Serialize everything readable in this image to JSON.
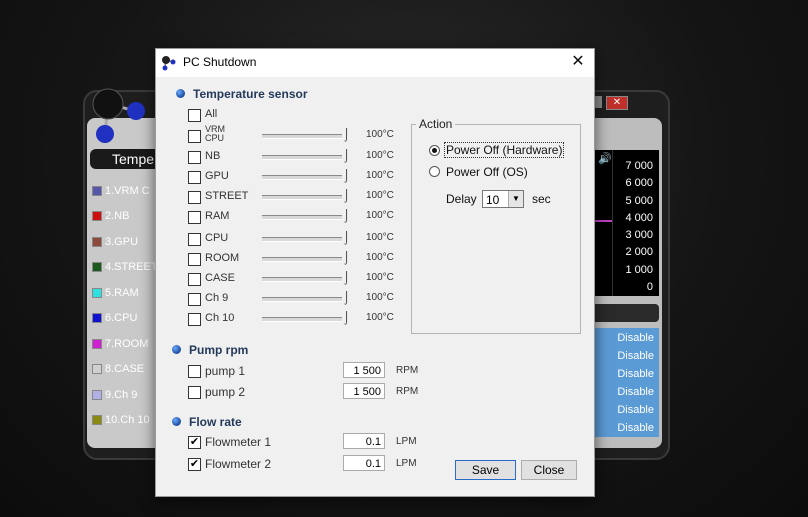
{
  "background_app": {
    "left_header": "Tempe",
    "channels": [
      {
        "label": "1.VRM C",
        "color": "#5555aa"
      },
      {
        "label": "2.NB",
        "color": "#d01010"
      },
      {
        "label": "3.GPU",
        "color": "#8b4a3a"
      },
      {
        "label": "4.STREET",
        "color": "#1a5a1a"
      },
      {
        "label": "5.RAM",
        "color": "#30e0e0"
      },
      {
        "label": "6.CPU",
        "color": "#1010d0"
      },
      {
        "label": "7.ROOM",
        "color": "#d020d0"
      },
      {
        "label": "8.CASE",
        "color": "#d0d0d0"
      },
      {
        "label": "9.Ch 9",
        "color": "#b0b0e8"
      },
      {
        "label": "10.Ch 10",
        "color": "#8a8a10"
      }
    ],
    "chart_ticks": [
      "7 000",
      "6 000",
      "5 000",
      "4 000",
      "3 000",
      "2 000",
      "1 000",
      "0"
    ],
    "disable_labels": [
      "Disable",
      "Disable",
      "Disable",
      "Disable",
      "Disable",
      "Disable"
    ],
    "close_glyph": "✕"
  },
  "dialog": {
    "title": "PC Shutdown",
    "close_glyph": "✕",
    "temperature": {
      "heading": "Temperature sensor",
      "all_label": "All",
      "sensors": [
        {
          "label": "VRM CPU",
          "temp": "100°C"
        },
        {
          "label": "NB",
          "temp": "100°C"
        },
        {
          "label": "GPU",
          "temp": "100°C"
        },
        {
          "label": "STREET",
          "temp": "100°C"
        },
        {
          "label": "RAM",
          "temp": "100°C"
        },
        {
          "label": "CPU",
          "temp": "100°C"
        },
        {
          "label": "ROOM",
          "temp": "100°C"
        },
        {
          "label": "CASE",
          "temp": "100°C"
        },
        {
          "label": "Ch 9",
          "temp": "100°C"
        },
        {
          "label": "Ch 10",
          "temp": "100°C"
        }
      ]
    },
    "pump": {
      "heading": "Pump rpm",
      "items": [
        {
          "label": "pump 1",
          "value": "1 500",
          "unit": "RPM"
        },
        {
          "label": "pump 2",
          "value": "1 500",
          "unit": "RPM"
        }
      ]
    },
    "flow": {
      "heading": "Flow rate",
      "items": [
        {
          "label": "Flowmeter 1",
          "value": "0.1",
          "unit": "LPM",
          "checked": true
        },
        {
          "label": "Flowmeter 2",
          "value": "0.1",
          "unit": "LPM",
          "checked": true
        }
      ]
    },
    "action": {
      "legend": "Action",
      "power_off_hardware": "Power Off (Hardware)",
      "power_off_os": "Power Off (OS)",
      "selected": "hardware",
      "delay_label": "Delay",
      "delay_value": "10",
      "delay_unit": "sec"
    },
    "buttons": {
      "save": "Save",
      "close": "Close"
    }
  }
}
